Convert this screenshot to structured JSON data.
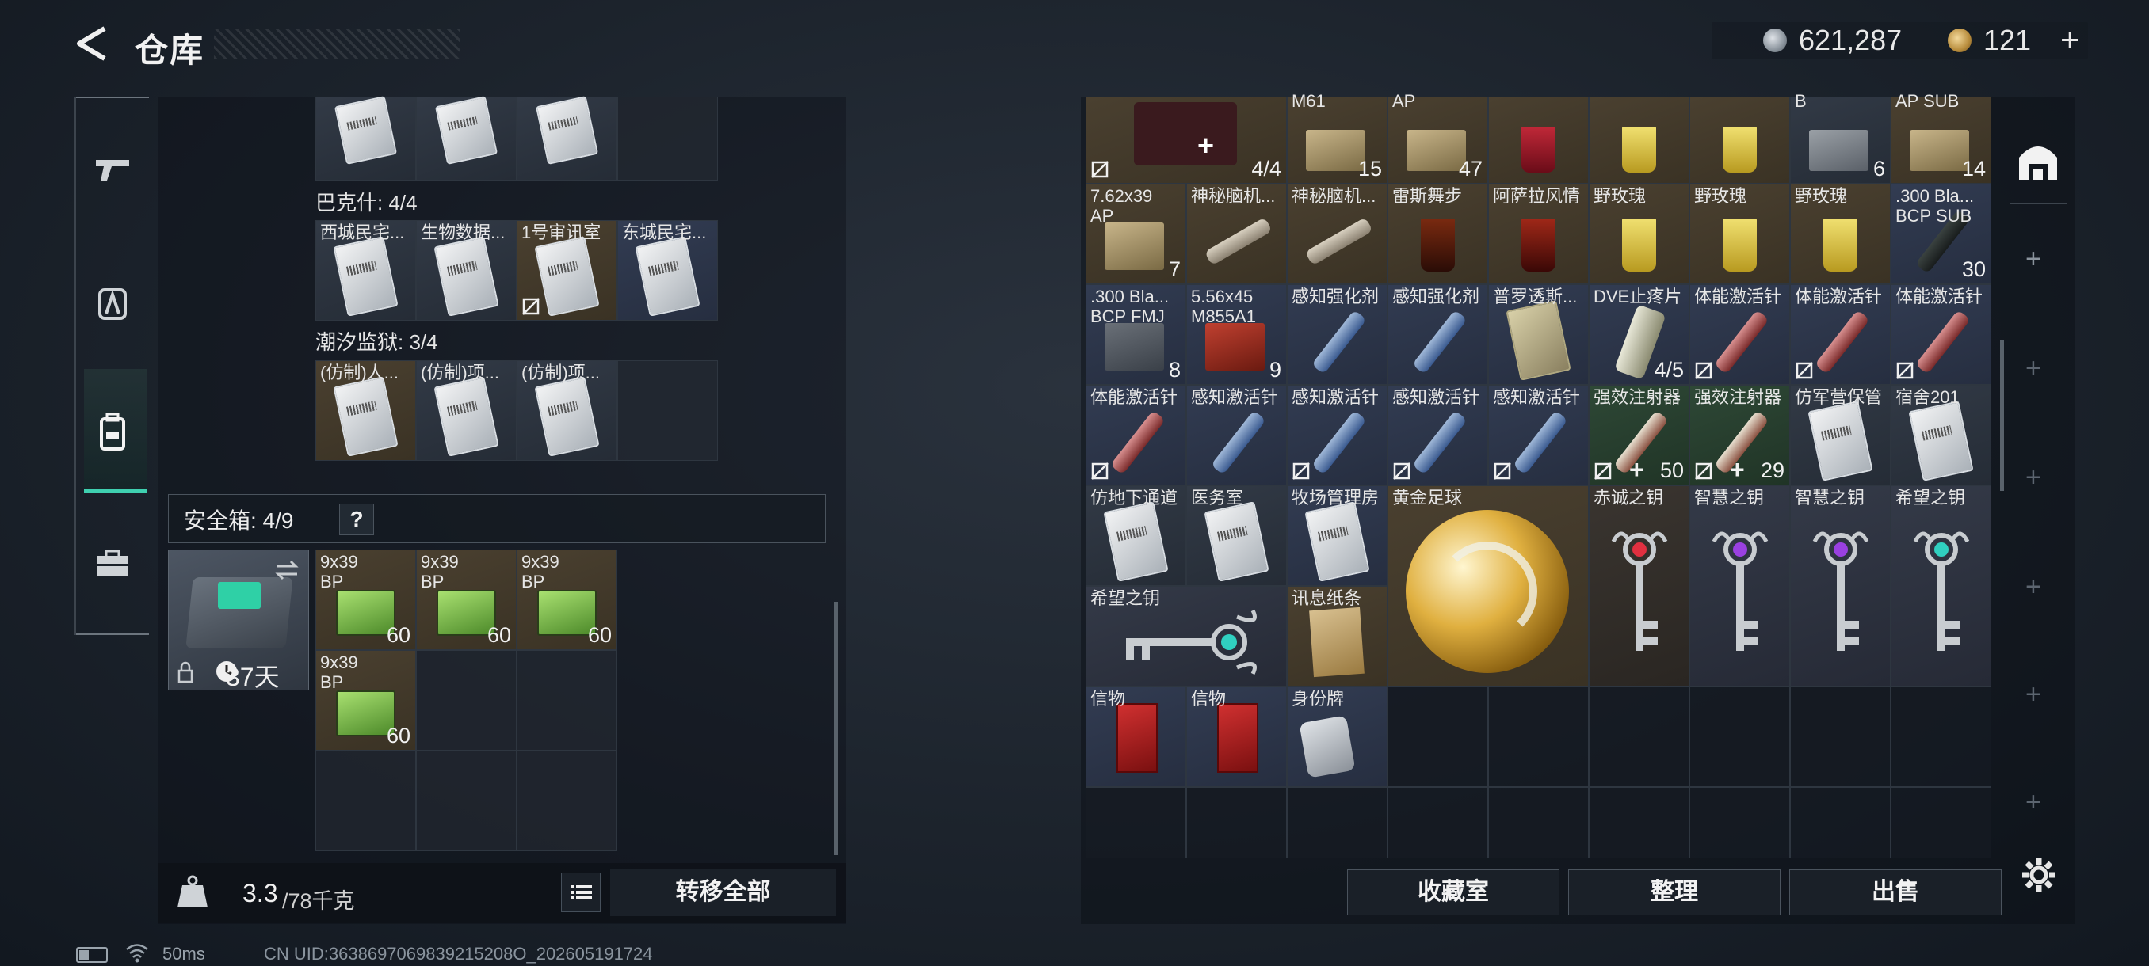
{
  "header": {
    "title": "仓库",
    "silver": "621,287",
    "gold": "121",
    "gold_plus": "+"
  },
  "nav": {
    "items": [
      "weapons",
      "armor",
      "backpack",
      "toolbox"
    ],
    "active": "backpack"
  },
  "left": {
    "sections": [
      {
        "label": "巴克什: 4/4",
        "items": [
          "西城民宅...",
          "生物数据...",
          "1号审讯室",
          "东城民宅..."
        ]
      },
      {
        "label": "潮汐监狱: 3/4",
        "items": [
          "(仿制)人...",
          "(仿制)项...",
          "(仿制)项..."
        ]
      }
    ],
    "safebox": {
      "label": "安全箱: 4/9",
      "help": "?",
      "days": "37天",
      "items": [
        {
          "title": "9x39 BP",
          "count": "60"
        },
        {
          "title": "9x39 BP",
          "count": "60"
        },
        {
          "title": "9x39 BP",
          "count": "60"
        },
        {
          "title": "9x39 BP",
          "count": "60"
        }
      ]
    },
    "weight": {
      "value": "3.3",
      "max": "/78千克"
    },
    "transfer_label": "转移全部"
  },
  "right": {
    "row0": [
      {
        "title": "",
        "count": "4/4"
      },
      {
        "title": "M61",
        "count": "15"
      },
      {
        "title": "AP",
        "count": "47"
      },
      {
        "title": "",
        "count": ""
      },
      {
        "title": "",
        "count": ""
      },
      {
        "title": "",
        "count": ""
      },
      {
        "title": "B",
        "count": "6"
      },
      {
        "title": "AP SUB",
        "count": "14"
      }
    ],
    "row1": [
      {
        "title": "7.62x39 AP",
        "count": "7"
      },
      {
        "title": "神秘脑机...",
        "count": ""
      },
      {
        "title": "神秘脑机...",
        "count": ""
      },
      {
        "title": "雷斯舞步",
        "count": ""
      },
      {
        "title": "阿萨拉风情",
        "count": ""
      },
      {
        "title": "野玫瑰",
        "count": ""
      },
      {
        "title": "野玫瑰",
        "count": ""
      },
      {
        "title": "野玫瑰",
        "count": ""
      },
      {
        "title": ".300 Bla... BCP SUB",
        "count": "30"
      }
    ],
    "row2": [
      {
        "title": ".300 Bla... BCP FMJ",
        "count": "8"
      },
      {
        "title": "5.56x45 M855A1",
        "count": "9"
      },
      {
        "title": "感知强化剂",
        "count": ""
      },
      {
        "title": "感知强化剂",
        "count": ""
      },
      {
        "title": "普罗透斯...",
        "count": ""
      },
      {
        "title": "DVE止疼片",
        "count": "4/5"
      },
      {
        "title": "体能激活针",
        "count": ""
      },
      {
        "title": "体能激活针",
        "count": ""
      },
      {
        "title": "体能激活针",
        "count": ""
      }
    ],
    "row3": [
      {
        "title": "体能激活针",
        "count": ""
      },
      {
        "title": "感知激活针",
        "count": ""
      },
      {
        "title": "感知激活针",
        "count": ""
      },
      {
        "title": "感知激活针",
        "count": ""
      },
      {
        "title": "感知激活针",
        "count": ""
      },
      {
        "title": "强效注射器",
        "count": "50"
      },
      {
        "title": "强效注射器",
        "count": "29"
      },
      {
        "title": "仿军营保管",
        "count": ""
      },
      {
        "title": "宿舍201",
        "count": ""
      }
    ],
    "row4": [
      {
        "title": "仿地下通道",
        "count": ""
      },
      {
        "title": "医务室",
        "count": ""
      },
      {
        "title": "牧场管理房",
        "count": ""
      },
      {
        "title": "黄金足球",
        "count": ""
      },
      {
        "title": "赤诚之钥",
        "count": ""
      },
      {
        "title": "智慧之钥",
        "count": ""
      },
      {
        "title": "智慧之钥",
        "count": ""
      },
      {
        "title": "希望之钥",
        "count": ""
      }
    ],
    "row5": [
      {
        "title": "希望之钥",
        "count": ""
      },
      {
        "title": "讯息纸条",
        "count": ""
      }
    ],
    "row6": [
      {
        "title": "信物",
        "count": ""
      },
      {
        "title": "信物",
        "count": ""
      },
      {
        "title": "身份牌",
        "count": ""
      }
    ],
    "buttons": {
      "collection": "收藏室",
      "sort": "整理",
      "sell": "出售"
    }
  },
  "status": {
    "ping": "50ms",
    "uid": "CN UID:3638697069839215208O_202605191724"
  },
  "colors": {
    "accent": "#3fd0b0",
    "panel": "#1a2028",
    "border": "#4a535d"
  }
}
